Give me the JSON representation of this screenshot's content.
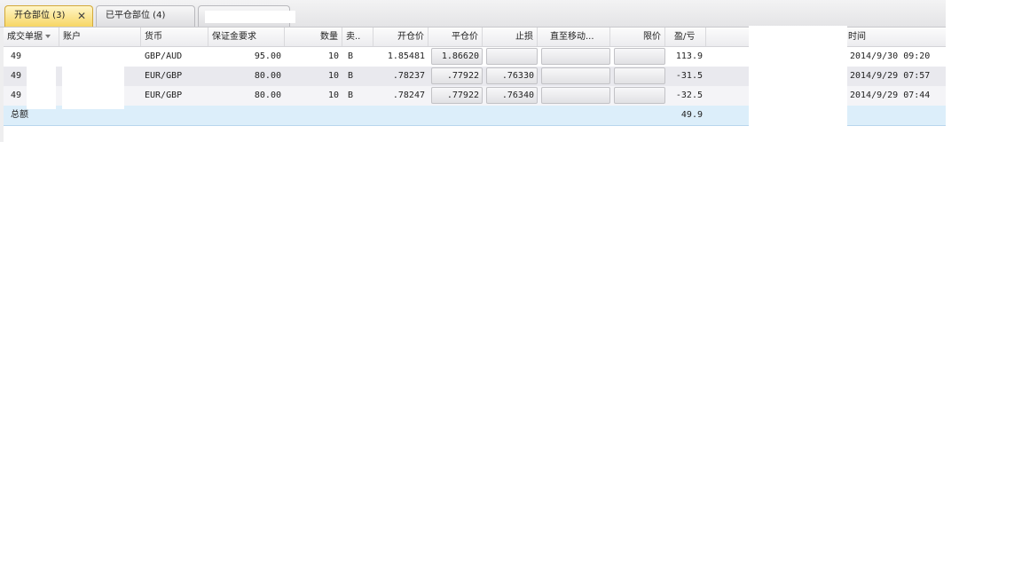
{
  "tabs": [
    {
      "label": "开仓部位 (3)",
      "close": "✕"
    },
    {
      "label": "已平仓部位 (4)"
    },
    {
      "label": ""
    }
  ],
  "columns": {
    "deal": "成交单据",
    "account": "账户",
    "currency": "货币",
    "margin": "保证金要求",
    "qty": "数量",
    "side": "卖..",
    "open_price": "开仓价",
    "close_price": "平仓价",
    "stop": "止损",
    "trailing": "直至移动...",
    "limit": "限价",
    "pl": "盈/亏",
    "time": "时间"
  },
  "rows": [
    {
      "deal": "49",
      "currency": "GBP/AUD",
      "margin": "95.00",
      "qty": "10",
      "side": "B",
      "open_price": "1.85481",
      "close_price": "1.86620",
      "stop": "",
      "trailing": "",
      "limit": "",
      "pl": "113.9",
      "time": "2014/9/30 09:20"
    },
    {
      "deal": "49",
      "currency": "EUR/GBP",
      "margin": "80.00",
      "qty": "10",
      "side": "B",
      "open_price": ".78237",
      "close_price": ".77922",
      "stop": ".76330",
      "trailing": "",
      "limit": "",
      "pl": "-31.5",
      "time": "2014/9/29 07:57"
    },
    {
      "deal": "49",
      "currency": "EUR/GBP",
      "margin": "80.00",
      "qty": "10",
      "side": "B",
      "open_price": ".78247",
      "close_price": ".77922",
      "stop": ".76340",
      "trailing": "",
      "limit": "",
      "pl": "-32.5",
      "time": "2014/9/29 07:44"
    }
  ],
  "total": {
    "label": "总额",
    "pl": "49.9"
  }
}
